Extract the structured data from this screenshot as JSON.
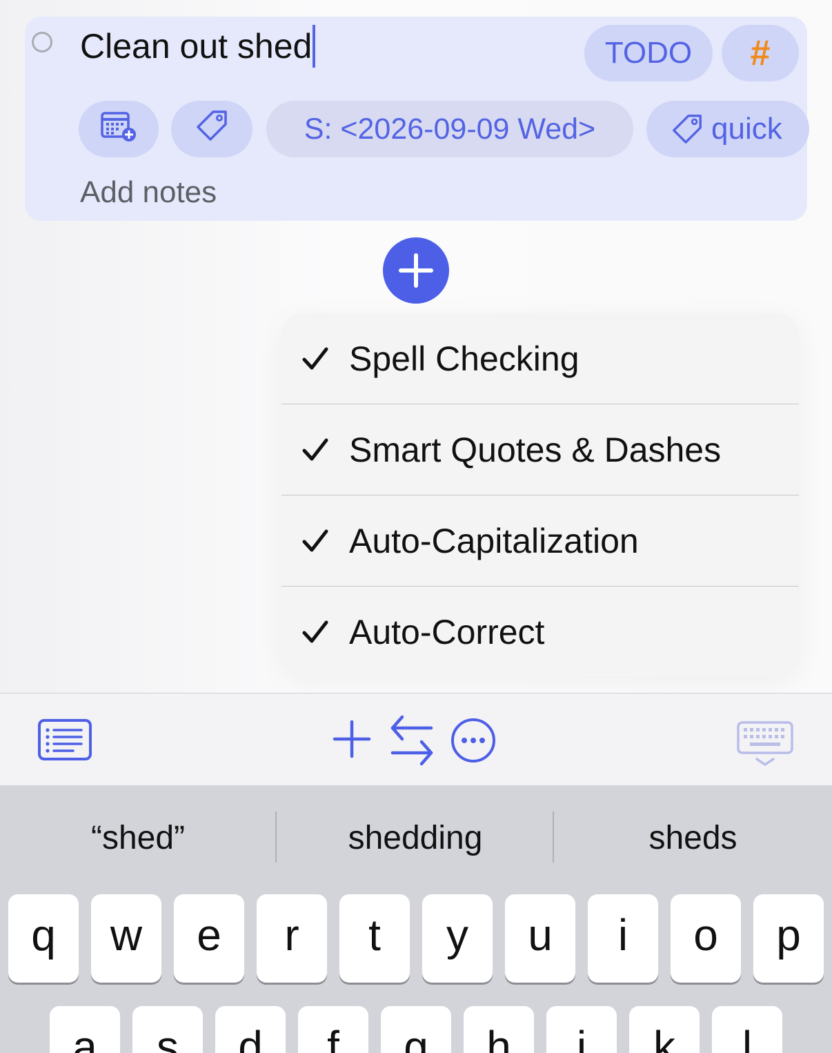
{
  "task": {
    "title": "Clean out shed",
    "state_label": "TODO",
    "hash_label": "#",
    "schedule_label": "S: <2026-09-09 Wed>",
    "tag_label": "quick",
    "notes_placeholder": "Add notes"
  },
  "menu": {
    "items": [
      {
        "label": "Spell Checking",
        "checked": true
      },
      {
        "label": "Smart Quotes & Dashes",
        "checked": true
      },
      {
        "label": "Auto-Capitalization",
        "checked": true
      },
      {
        "label": "Auto-Correct",
        "checked": true
      }
    ]
  },
  "toolbar": {
    "icons": [
      "list-icon",
      "plus-icon",
      "swap-arrows-icon",
      "more-icon",
      "keyboard-dismiss-icon"
    ]
  },
  "keyboard": {
    "suggestions": [
      "“shed”",
      "shedding",
      "sheds"
    ],
    "row1": [
      "q",
      "w",
      "e",
      "r",
      "t",
      "y",
      "u",
      "i",
      "o",
      "p"
    ],
    "row2": [
      "a",
      "s",
      "d",
      "f",
      "g",
      "h",
      "j",
      "k",
      "l"
    ]
  },
  "colors": {
    "accent": "#4d5fe6",
    "card_bg": "#e6e9fb",
    "pill_bg": "#cfd5f6",
    "hash": "#f08a1c",
    "keyboard_bg": "#d2d4da"
  }
}
